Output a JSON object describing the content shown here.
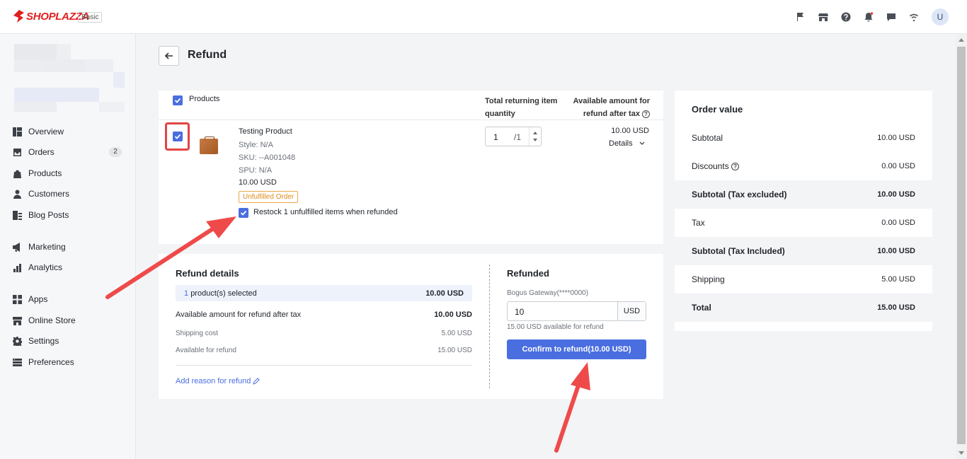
{
  "app": {
    "brand": "SHOPLAZZA",
    "plan": "Basic",
    "user_initial": "U"
  },
  "top_icons": [
    "flag-icon",
    "store-icon",
    "help-icon",
    "bell-icon",
    "chat-icon",
    "wifi-icon"
  ],
  "sidebar": {
    "items": [
      {
        "label": "Overview",
        "icon": "overview-icon"
      },
      {
        "label": "Orders",
        "icon": "orders-icon",
        "count": "2"
      },
      {
        "label": "Products",
        "icon": "products-icon"
      },
      {
        "label": "Customers",
        "icon": "customers-icon"
      },
      {
        "label": "Blog Posts",
        "icon": "blog-icon"
      },
      {
        "label": "Marketing",
        "icon": "marketing-icon"
      },
      {
        "label": "Analytics",
        "icon": "analytics-icon"
      },
      {
        "label": "Apps",
        "icon": "apps-icon"
      },
      {
        "label": "Online Store",
        "icon": "store-icon"
      },
      {
        "label": "Settings",
        "icon": "settings-icon"
      },
      {
        "label": "Preferences",
        "icon": "preferences-icon"
      }
    ]
  },
  "page": {
    "title": "Refund"
  },
  "products": {
    "header_label": "Products",
    "col_qty": [
      "Total returning item",
      "quantity"
    ],
    "col_amount": [
      "Available amount for",
      "refund after tax"
    ],
    "item": {
      "name": "Testing Product",
      "style": "Style: N/A",
      "sku": "SKU: --A001048",
      "spu": "SPU: N/A",
      "price": "10.00 USD",
      "status_tag": "Unfulfilled Order",
      "qty_value": "1",
      "qty_total": "/1",
      "amount": "10.00 USD",
      "details_label": "Details"
    },
    "restock_label": "Restock 1 unfulfilled items when refunded"
  },
  "refund_details": {
    "title": "Refund details",
    "selected_count": "1",
    "selected_text": "product(s) selected",
    "selected_amount": "10.00 USD",
    "avail_after_tax_label": "Available amount for refund after tax",
    "avail_after_tax_value": "10.00 USD",
    "shipping_label": "Shipping cost",
    "shipping_value": "5.00 USD",
    "available_label": "Available for refund",
    "available_value": "15.00 USD",
    "reason_link": "Add reason for refund"
  },
  "refunded": {
    "title": "Refunded",
    "gateway": "Bogus Gateway(****0000)",
    "amount_value": "10",
    "currency": "USD",
    "available_note": "15.00 USD available for refund",
    "confirm_label": "Confirm to refund(10.00 USD)"
  },
  "order_value": {
    "title": "Order value",
    "rows": [
      {
        "label": "Subtotal",
        "value": "10.00 USD",
        "bold": false
      },
      {
        "label": "Discounts",
        "value": "0.00 USD",
        "bold": false
      },
      {
        "label": "Subtotal (Tax excluded)",
        "value": "10.00 USD",
        "bold": true
      },
      {
        "label": "Tax",
        "value": "0.00 USD",
        "bold": false
      },
      {
        "label": "Subtotal (Tax Included)",
        "value": "10.00 USD",
        "bold": true
      },
      {
        "label": "Shipping",
        "value": "5.00 USD",
        "bold": false
      },
      {
        "label": "Total",
        "value": "15.00 USD",
        "bold": true
      }
    ]
  },
  "colors": {
    "accent": "#4a6ee0",
    "brand": "#e02020",
    "annotation": "#e24444",
    "warning": "#e08a1b"
  }
}
